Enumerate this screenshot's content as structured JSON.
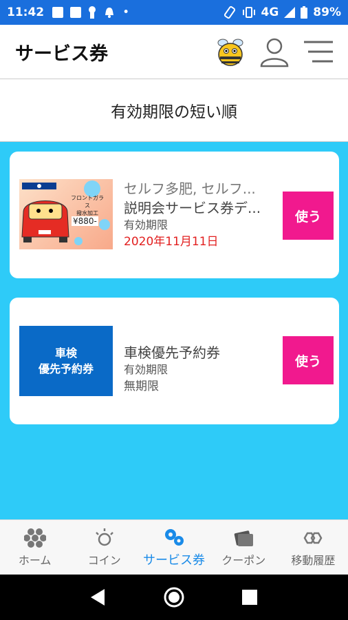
{
  "status": {
    "time": "11:42",
    "network": "4G",
    "battery": "89%"
  },
  "header": {
    "title": "サービス券"
  },
  "sort": {
    "label": "有効期限の短い順"
  },
  "coupons": [
    {
      "thumb_lines": [
        "フロントガラス",
        "撥水加工",
        "¥880-"
      ],
      "store": "セルフ多肥, セルフ...",
      "name": "説明会サービス券デ...",
      "expiry_label": "有効期限",
      "expiry": "2020年11月11日",
      "use_label": "使う"
    },
    {
      "thumb_lines": [
        "車検",
        "優先予約券"
      ],
      "name": "車検優先予約券",
      "expiry_label": "有効期限",
      "expiry": "無期限",
      "use_label": "使う"
    }
  ],
  "nav": [
    {
      "label": "ホーム",
      "icon": "hexagons-icon"
    },
    {
      "label": "コイン",
      "icon": "coin-sparkle-icon"
    },
    {
      "label": "サービス券",
      "icon": "service-ticket-icon",
      "active": true
    },
    {
      "label": "クーポン",
      "icon": "coupon-icon"
    },
    {
      "label": "移動履歴",
      "icon": "link-icon"
    }
  ],
  "colors": {
    "statusbar": "#1a6fdd",
    "content_bg": "#2ecbf8",
    "use_button": "#f1198e",
    "active_nav": "#1a8be8",
    "expiry_red": "#e21f1f"
  }
}
